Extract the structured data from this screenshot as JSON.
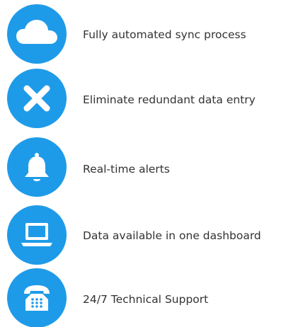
{
  "accent_color": "#1e9be8",
  "features": [
    {
      "icon": "cloud-icon",
      "label": "Fully automated sync process"
    },
    {
      "icon": "close-x-icon",
      "label": "Eliminate redundant data entry"
    },
    {
      "icon": "bell-icon",
      "label": "Real-time alerts"
    },
    {
      "icon": "laptop-icon",
      "label": "Data available in one dashboard"
    },
    {
      "icon": "telephone-icon",
      "label": "24/7 Technical Support"
    }
  ]
}
